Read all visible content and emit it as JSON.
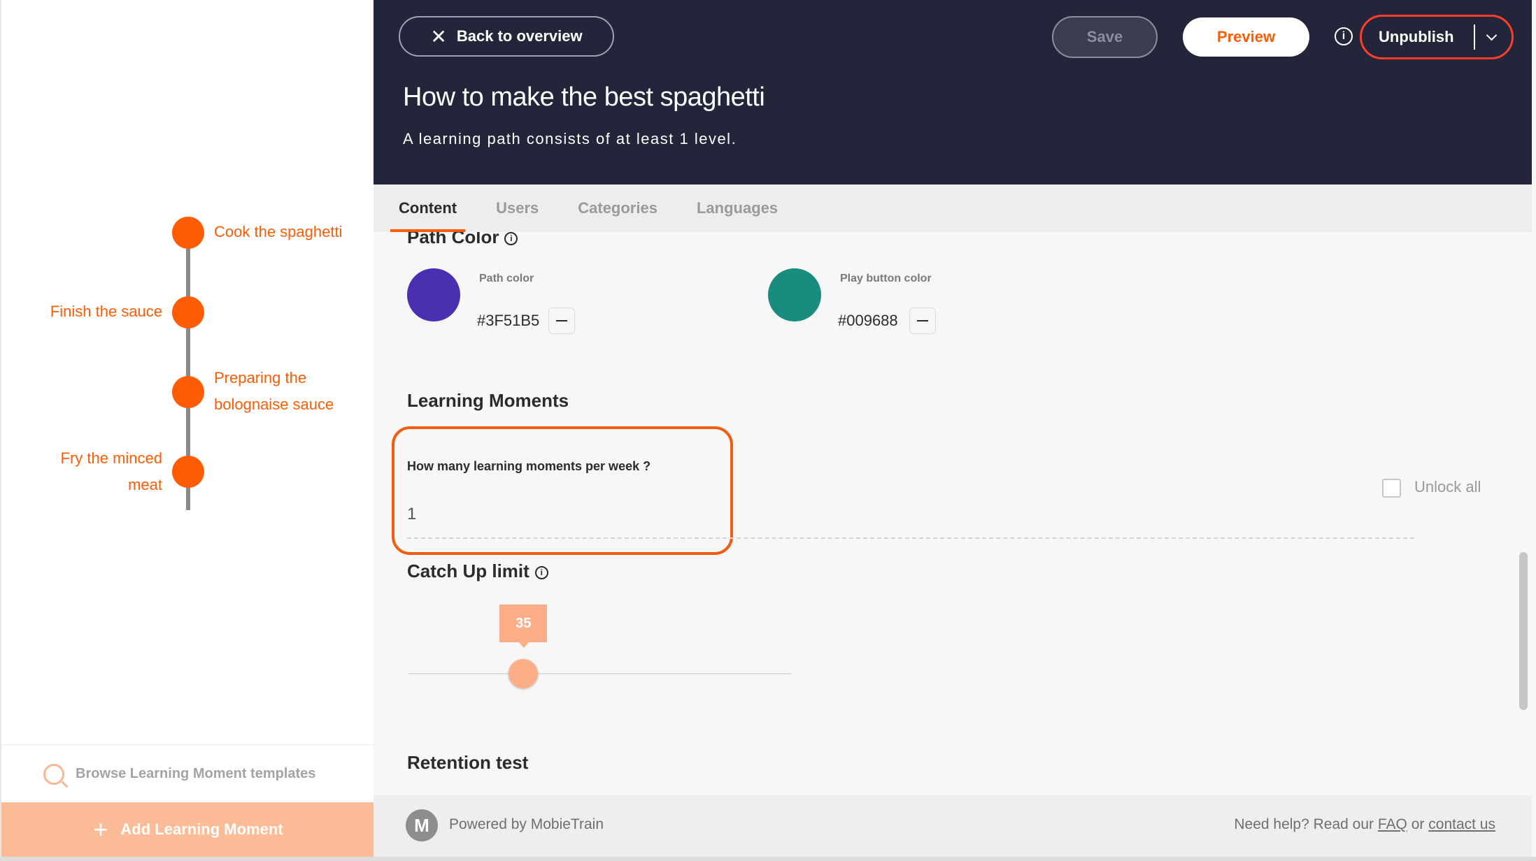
{
  "sidebar": {
    "path_items": [
      {
        "label": "Cook the spaghetti"
      },
      {
        "label": "Finish the sauce"
      },
      {
        "label_line1": "Preparing the",
        "label_line2": "bolognaise sauce"
      },
      {
        "label_line1": "Fry the minced",
        "label_line2": "meat"
      }
    ],
    "browse_templates": "Browse Learning Moment templates",
    "add_learning_moment": "Add Learning Moment"
  },
  "header": {
    "back_label": "Back to overview",
    "save_label": "Save",
    "preview_label": "Preview",
    "info_symbol": "i",
    "unpublish_label": "Unpublish",
    "title": "How to make the best spaghetti",
    "subtitle": "A learning path consists of at least 1 level."
  },
  "tabs": [
    {
      "label": "Content",
      "active": true
    },
    {
      "label": "Users",
      "active": false
    },
    {
      "label": "Categories",
      "active": false
    },
    {
      "label": "Languages",
      "active": false
    }
  ],
  "path_color": {
    "title": "Path Color",
    "path": {
      "label": "Path color",
      "hex": "#3F51B5",
      "swatch": "#4a2fb1"
    },
    "play_button": {
      "label": "Play button color",
      "hex": "#009688",
      "swatch": "#1a8c7e"
    }
  },
  "learning_moments": {
    "title": "Learning Moments",
    "field_label": "How many learning moments per week ?",
    "field_value": "1",
    "unlock_all_label": "Unlock all",
    "unlock_all_checked": false
  },
  "catch_up": {
    "title": "Catch Up limit",
    "value": "35",
    "fraction": 0.3
  },
  "retention": {
    "title": "Retention test"
  },
  "footer": {
    "logo_letter": "M",
    "powered_by": "Powered by MobieTrain",
    "help_prefix": "Need help? Read our",
    "faq": "FAQ",
    "or": "or",
    "contact": "contact us"
  },
  "colors": {
    "accent": "#fe5c05",
    "header_bg": "#23263a",
    "unpublish_border": "#fe3d2a"
  }
}
